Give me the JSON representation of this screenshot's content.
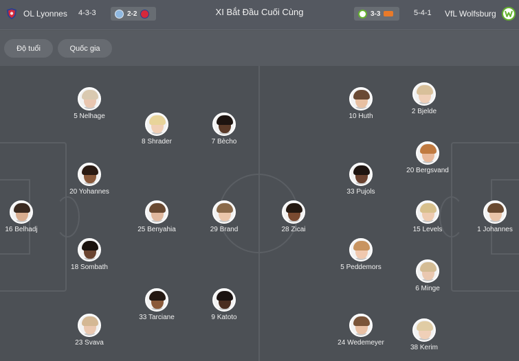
{
  "header": {
    "home_team": "OL Lyonnes",
    "home_formation": "4-3-3",
    "home_score": "2-2",
    "title": "XI Bắt Đầu Cuối Cùng",
    "away_score": "3-3",
    "away_formation": "5-4-1",
    "away_team": "VfL Wolfsburg"
  },
  "filters": [
    "Độ tuổi",
    "Quốc gia"
  ],
  "players": [
    {
      "label": "5 Nelhage",
      "skin": "#e9c6b0",
      "hair": "#d9c9b0"
    },
    {
      "label": "8 Shrader",
      "skin": "#f0cfb5",
      "hair": "#e8d49a"
    },
    {
      "label": "7 Bècho",
      "skin": "#5a3a28",
      "hair": "#1d1410"
    },
    {
      "label": "20 Yohannes",
      "skin": "#8a5a3c",
      "hair": "#2a1a12"
    },
    {
      "label": "16 Belhadj",
      "skin": "#d8ad8f",
      "hair": "#3a2a20"
    },
    {
      "label": "25 Benyahia",
      "skin": "#e0b89e",
      "hair": "#6a4a32"
    },
    {
      "label": "29 Brand",
      "skin": "#eac6ab",
      "hair": "#8a6a4a"
    },
    {
      "label": "18 Sombath",
      "skin": "#6a4430",
      "hair": "#1a120e"
    },
    {
      "label": "33 Tarciane",
      "skin": "#8a5a3a",
      "hair": "#241812"
    },
    {
      "label": "9 Katoto",
      "skin": "#4a2e20",
      "hair": "#1a1210"
    },
    {
      "label": "23 Svava",
      "skin": "#eac8b0",
      "hair": "#d4b894"
    },
    {
      "label": "10 Huth",
      "skin": "#e8c0a2",
      "hair": "#6a4a34"
    },
    {
      "label": "2 Bjelde",
      "skin": "#efcfb8",
      "hair": "#d8c09a"
    },
    {
      "label": "33 Pujols",
      "skin": "#6a4230",
      "hair": "#1e1410"
    },
    {
      "label": "20 Bergsvand",
      "skin": "#e8b89a",
      "hair": "#c07a40"
    },
    {
      "label": "28 Zicai",
      "skin": "#7a4a30",
      "hair": "#241810"
    },
    {
      "label": "15 Levels",
      "skin": "#eecbb0",
      "hair": "#d8c08c"
    },
    {
      "label": "1 Johannes",
      "skin": "#eac4a8",
      "hair": "#6a4a30"
    },
    {
      "label": "5 Peddemors",
      "skin": "#f0c8ae",
      "hair": "#c89460"
    },
    {
      "label": "6 Minge",
      "skin": "#eac8b0",
      "hair": "#d4bc94"
    },
    {
      "label": "24 Wedemeyer",
      "skin": "#e8c0a4",
      "hair": "#7a5438"
    },
    {
      "label": "38 Kerim",
      "skin": "#f0d0b8",
      "hair": "#e0cca4"
    }
  ],
  "colors": {
    "lyon_red": "#d6293b",
    "wolfsburg_green": "#65b32e",
    "pitch": "#4c5055"
  },
  "icons": {
    "home_logo": "lyon-crest-icon",
    "away_logo": "wolfsburg-crest-icon"
  }
}
